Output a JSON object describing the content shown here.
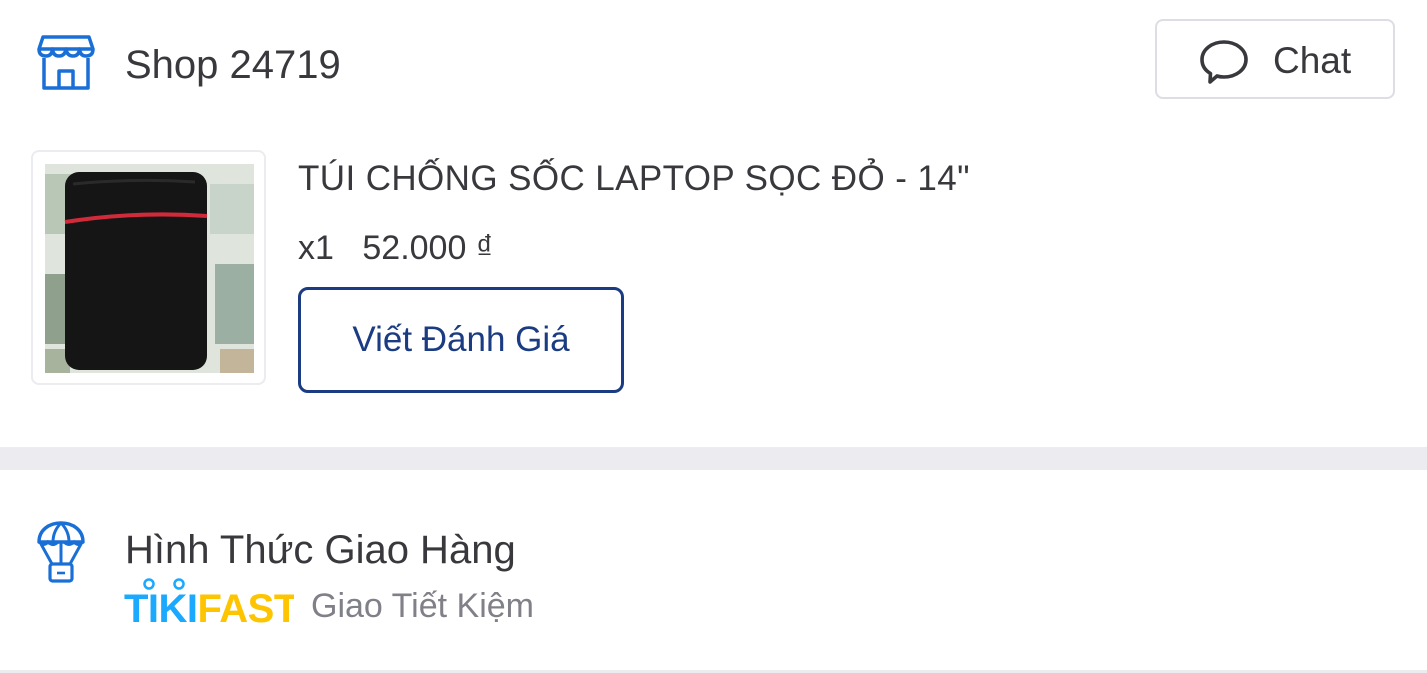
{
  "shop": {
    "name": "Shop 24719",
    "icon": "store-icon",
    "chat_label": "Chat",
    "chat_icon": "chat-bubble-icon"
  },
  "product": {
    "name": "TÚI CHỐNG SỐC LAPTOP SỌC ĐỎ - 14\"",
    "quantity": "x1",
    "price": "52.000 ₫",
    "review_button_label": "Viết Đánh Giá",
    "image": "laptop-sleeve-thumbnail"
  },
  "shipping": {
    "title": "Hình Thức Giao Hàng",
    "icon": "parachute-icon",
    "brand": "TIKIFAST",
    "method": "Giao Tiết Kiệm"
  },
  "colors": {
    "primary": "#1b3c83",
    "text": "#38383d",
    "muted": "#808089",
    "border": "#dddde3",
    "divider": "#ebebf0",
    "icon_blue": "#1a6fd6",
    "tiki_blue": "#1ba8ff",
    "fast_yellow": "#ffc400"
  }
}
